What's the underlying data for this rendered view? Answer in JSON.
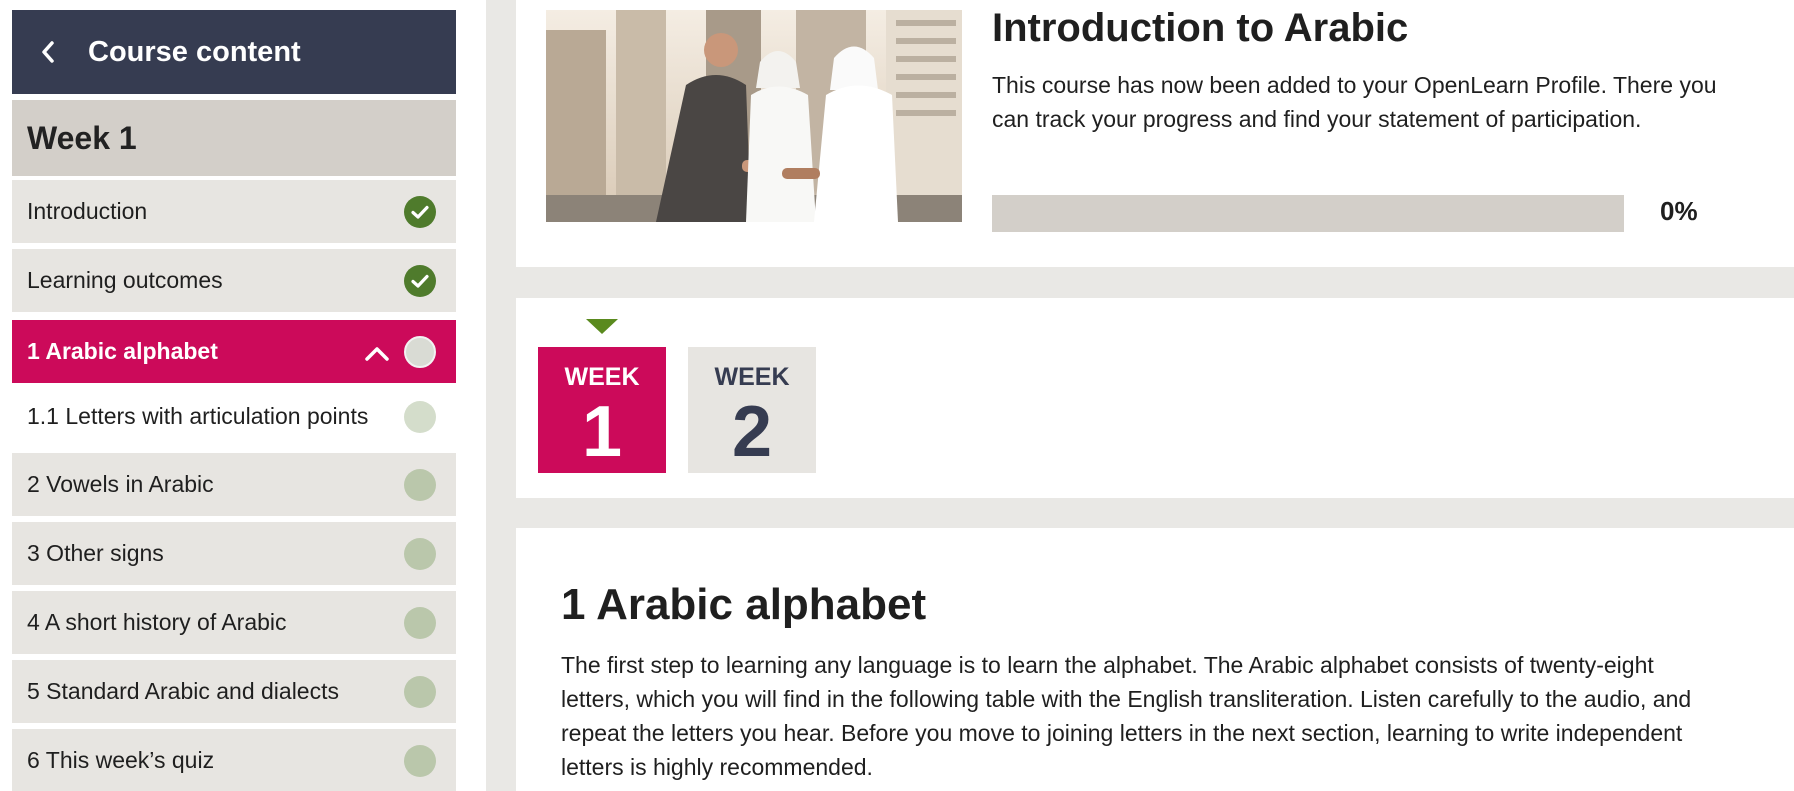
{
  "sidebar": {
    "header_title": "Course content",
    "week_title": "Week 1",
    "items": [
      {
        "label": "Introduction",
        "status": "complete"
      },
      {
        "label": "Learning outcomes",
        "status": "complete"
      },
      {
        "label": "1 Arabic alphabet",
        "status": "active"
      },
      {
        "label": "1.1 Letters with articulation points",
        "status": "incomplete"
      },
      {
        "label": "2 Vowels in Arabic",
        "status": "incomplete"
      },
      {
        "label": "3 Other signs",
        "status": "incomplete"
      },
      {
        "label": "4 A short history of Arabic",
        "status": "incomplete"
      },
      {
        "label": "5 Standard Arabic and dialects",
        "status": "incomplete"
      },
      {
        "label": "6 This week’s quiz",
        "status": "incomplete"
      }
    ]
  },
  "course": {
    "title": "Introduction to Arabic",
    "description": "This course has now been added to your OpenLearn Profile. There you can track your progress and find your statement of participation.",
    "progress_percent": 0,
    "progress_label": "0%"
  },
  "weeks": [
    {
      "label": "WEEK",
      "number": "1",
      "selected": true
    },
    {
      "label": "WEEK",
      "number": "2",
      "selected": false
    }
  ],
  "section": {
    "title": "1 Arabic alphabet",
    "body": "The first step to learning any language is to learn the alphabet. The Arabic alphabet consists of twenty-eight letters, which you will find in the following table with the English transliteration. Listen carefully to the audio, and repeat the letters you hear. Before you move to joining letters in the next section, learning to write independent letters is highly recommended."
  },
  "colors": {
    "nav_dark": "#363c51",
    "accent_magenta": "#cc0a5a",
    "complete_green": "#4f7b2c",
    "pending_green": "#bac7ab"
  }
}
